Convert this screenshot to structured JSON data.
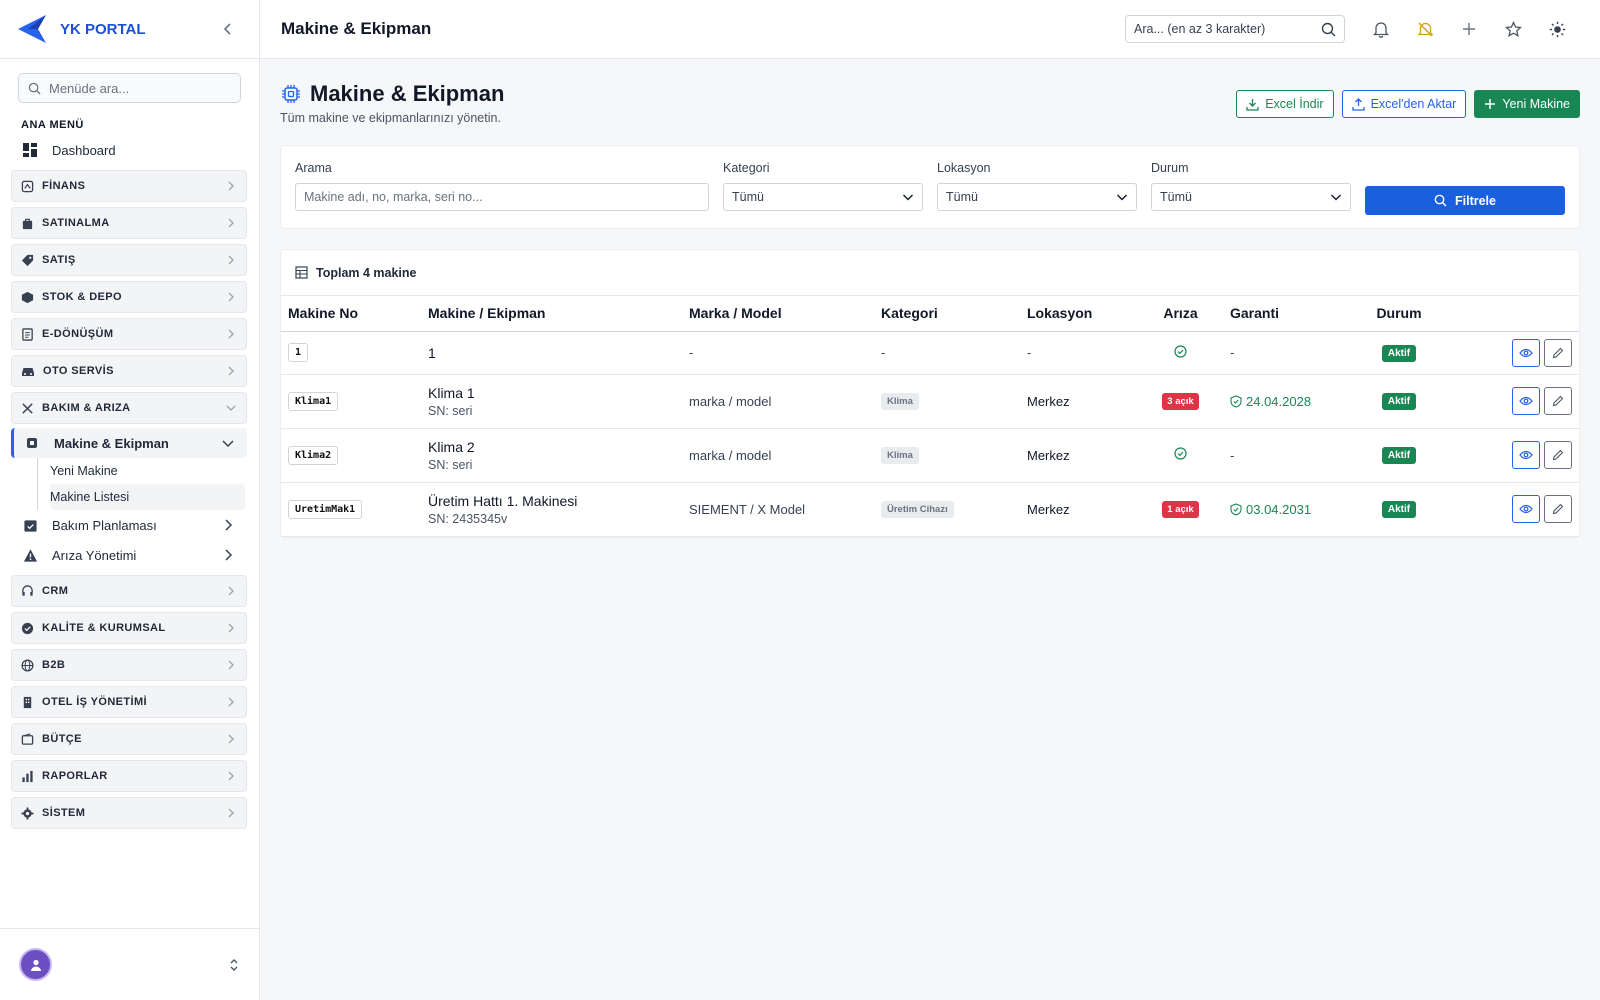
{
  "brand": {
    "name": "YK PORTAL",
    "accent": "#1d4ed8"
  },
  "sidebar": {
    "search_placeholder": "Menüde ara...",
    "section_title": "ANA MENÜ",
    "dashboard": "Dashboard",
    "groups_top": [
      "FİNANS",
      "SATINALMA",
      "SATIŞ",
      "STOK & DEPO",
      "E-DÖNÜŞÜM",
      "OTO SERVİS"
    ],
    "open_group": "BAKIM & ARIZA",
    "machine_item": "Makine & Ekipman",
    "machine_children": [
      "Yeni Makine",
      "Makine Listesi"
    ],
    "maintenance_plan": "Bakım Planlaması",
    "fault_management": "Arıza Yönetimi",
    "groups_bottom": [
      "CRM",
      "KALİTE & KURUMSAL",
      "B2B",
      "OTEL İŞ YÖNETİMİ",
      "BÜTÇE",
      "RAPORLAR",
      "SİSTEM"
    ]
  },
  "header": {
    "title": "Makine & Ekipman",
    "search_placeholder": "Ara... (en az 3 karakter)"
  },
  "page": {
    "title": "Makine & Ekipman",
    "description": "Tüm makine ve ekipmanlarınızı yönetin.",
    "btn_excel_download": "Excel İndir",
    "btn_excel_import": "Excel'den Aktar",
    "btn_new_machine": "Yeni Makine"
  },
  "filters": {
    "search_label": "Arama",
    "search_placeholder": "Makine adı, no, marka, seri no...",
    "category_label": "Kategori",
    "category_value": "Tümü",
    "location_label": "Lokasyon",
    "location_value": "Tümü",
    "status_label": "Durum",
    "status_value": "Tümü",
    "filter_button": "Filtrele"
  },
  "table": {
    "summary": "Toplam 4 makine",
    "headers": [
      "Makine No",
      "Makine / Ekipman",
      "Marka / Model",
      "Kategori",
      "Lokasyon",
      "Arıza",
      "Garanti",
      "Durum"
    ],
    "rows": [
      {
        "no": "1",
        "name": "1",
        "sn": "",
        "brand": "-",
        "category": "-",
        "location": "-",
        "fault": "",
        "warranty": "-",
        "status": "Aktif"
      },
      {
        "no": "Klima1",
        "name": "Klima 1",
        "sn": "SN: seri",
        "brand": "marka / model",
        "category": "Klima",
        "location": "Merkez",
        "fault": "3 açık",
        "warranty": "24.04.2028",
        "status": "Aktif"
      },
      {
        "no": "Klima2",
        "name": "Klima 2",
        "sn": "SN: seri",
        "brand": "marka / model",
        "category": "Klima",
        "location": "Merkez",
        "fault": "",
        "warranty": "-",
        "status": "Aktif"
      },
      {
        "no": "UretimMak1",
        "name": "Üretim Hattı 1. Makinesi",
        "sn": "SN: 2435345v",
        "brand": "SIEMENT / X Model",
        "category": "Üretim Cihazı",
        "location": "Merkez",
        "fault": "1 açık",
        "warranty": "03.04.2031",
        "status": "Aktif"
      }
    ]
  },
  "colors": {
    "primary": "#1a5fe0",
    "success": "#198754",
    "danger": "#dc3545"
  }
}
